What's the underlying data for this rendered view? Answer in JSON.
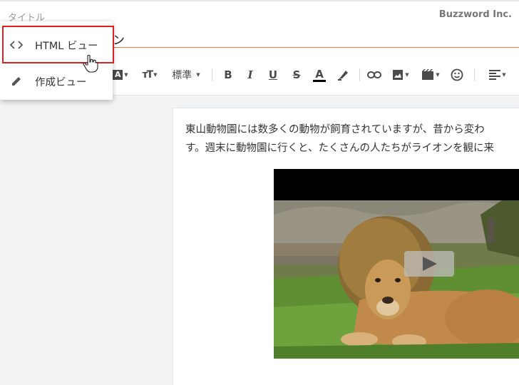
{
  "header": {
    "title_label": "タイトル",
    "brand": "Buzzword Inc.",
    "title_value_visible": "ン"
  },
  "toolbar": {
    "font_color_icon": "font-color-a-icon",
    "text_size_icon": "text-size-icon",
    "paragraph_style": "標準",
    "items": [
      "bold-icon",
      "italic-icon",
      "underline-icon",
      "strikethrough-icon",
      "text-color-icon",
      "highlighter-icon",
      "link-icon",
      "image-icon",
      "video-icon",
      "emoji-icon",
      "align-icon"
    ],
    "text_color_underline": "#000000",
    "highlighter_color": "#4a4a4a"
  },
  "editor": {
    "paragraph_line1": " 東山動物園には数多くの動物が飼育されていますが、昔から変わ",
    "paragraph_line2": "す。週末に動物園に行くと、たくさんの人たちがライオンを観に来",
    "video_content": "lion-photo"
  },
  "menu": {
    "items": [
      {
        "icon": "code-icon",
        "label": "HTML ビュー",
        "highlighted": true
      },
      {
        "icon": "pencil-icon",
        "label": "作成ビュー",
        "highlighted": false
      }
    ],
    "highlight_color": "#e02020"
  },
  "colors": {
    "accent_underline": "#e07a50",
    "background": "#f2f3f4"
  }
}
